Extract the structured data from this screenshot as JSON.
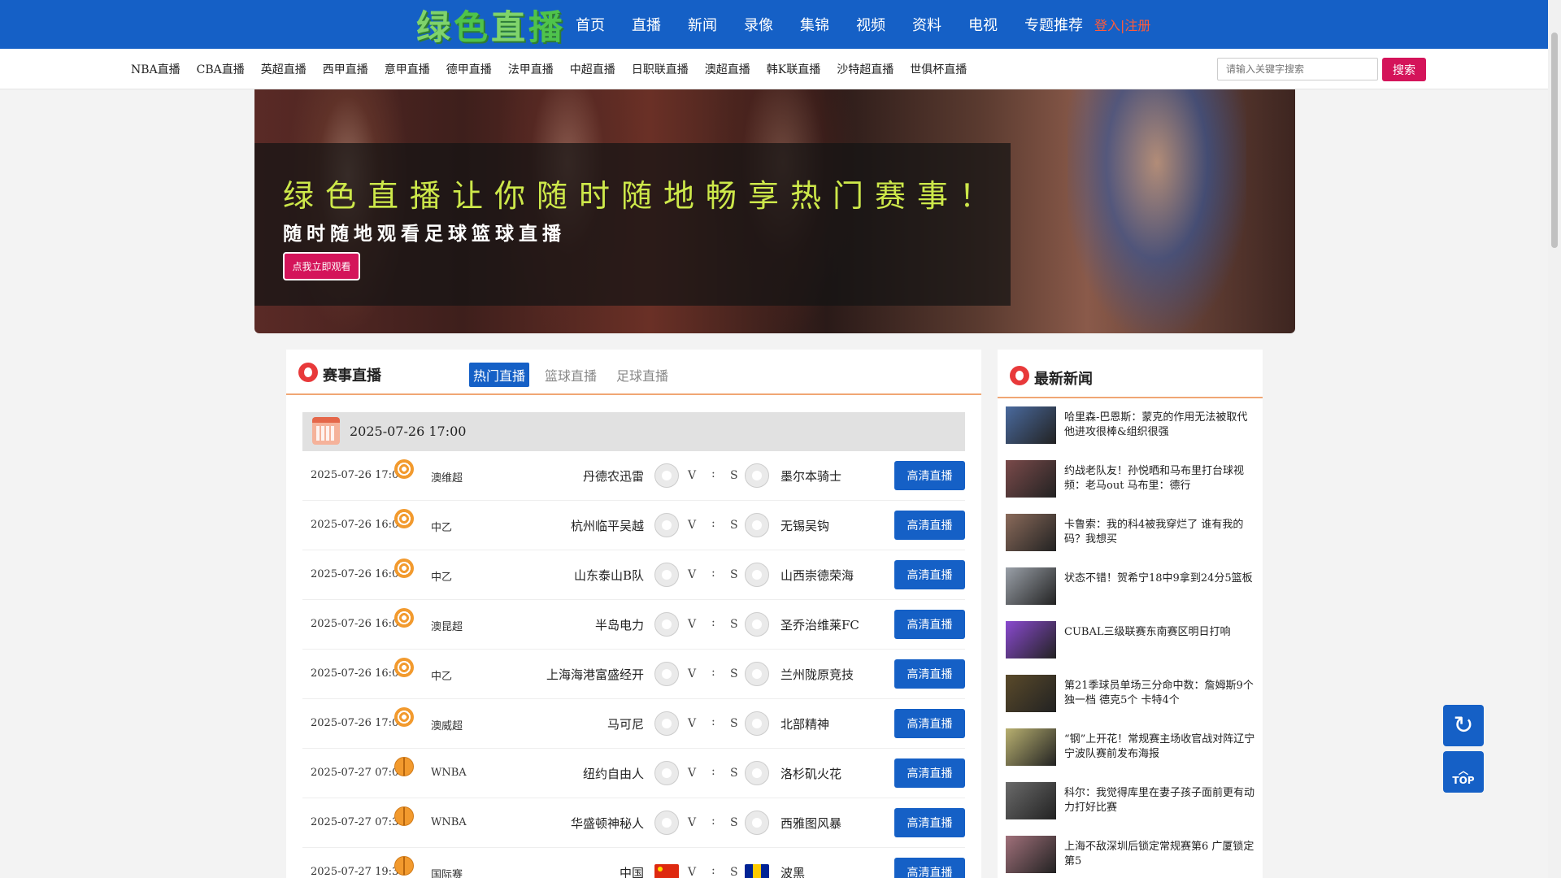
{
  "header": {
    "logo_chars": [
      "绿",
      "色",
      "直",
      "播"
    ],
    "nav": [
      "首页",
      "直播",
      "新闻",
      "录像",
      "集锦",
      "视频",
      "资料",
      "电视",
      "专题推荐"
    ],
    "login": "登入|注册"
  },
  "subnav": {
    "links": [
      "NBA直播",
      "CBA直播",
      "英超直播",
      "西甲直播",
      "意甲直播",
      "德甲直播",
      "法甲直播",
      "中超直播",
      "日职联直播",
      "澳超直播",
      "韩K联直播",
      "沙特超直播",
      "世俱杯直播"
    ],
    "search_placeholder": "请输入关键字搜索",
    "search_button": "搜索"
  },
  "banner": {
    "headline": "绿色直播让你随时随地畅享热门赛事！",
    "subline": "随时随地观看足球篮球直播",
    "cta": "点我立即观看"
  },
  "live": {
    "title": "赛事直播",
    "tabs": [
      "热门直播",
      "篮球直播",
      "足球直播"
    ],
    "date": "2025-07-26 17:00",
    "matches": [
      {
        "time": "2025-07-26 17:00",
        "sport": "soccer",
        "league": "澳维超",
        "home": "丹德农迅雷",
        "away": "墨尔本骑士",
        "v": "V",
        "colon": ":",
        "s": "S",
        "button": "高清直播"
      },
      {
        "time": "2025-07-26 16:00",
        "sport": "soccer",
        "league": "中乙",
        "home": "杭州临平吴越",
        "away": "无锡吴钩",
        "v": "V",
        "colon": ":",
        "s": "S",
        "button": "高清直播"
      },
      {
        "time": "2025-07-26 16:00",
        "sport": "soccer",
        "league": "中乙",
        "home": "山东泰山B队",
        "away": "山西崇德荣海",
        "v": "V",
        "colon": ":",
        "s": "S",
        "button": "高清直播"
      },
      {
        "time": "2025-07-26 16:00",
        "sport": "soccer",
        "league": "澳昆超",
        "home": "半岛电力",
        "away": "圣乔治维莱FC",
        "v": "V",
        "colon": ":",
        "s": "S",
        "button": "高清直播"
      },
      {
        "time": "2025-07-26 16:00",
        "sport": "soccer",
        "league": "中乙",
        "home": "上海海港富盛经开",
        "away": "兰州陇原竞技",
        "v": "V",
        "colon": ":",
        "s": "S",
        "button": "高清直播"
      },
      {
        "time": "2025-07-26 17:00",
        "sport": "soccer",
        "league": "澳威超",
        "home": "马可尼",
        "away": "北部精神",
        "v": "V",
        "colon": ":",
        "s": "S",
        "button": "高清直播"
      },
      {
        "time": "2025-07-27 07:00",
        "sport": "basket",
        "league": "WNBA",
        "home": "纽约自由人",
        "away": "洛杉矶火花",
        "v": "V",
        "colon": ":",
        "s": "S",
        "button": "高清直播"
      },
      {
        "time": "2025-07-27 07:30",
        "sport": "basket",
        "league": "WNBA",
        "home": "华盛顿神秘人",
        "away": "西雅图风暴",
        "v": "V",
        "colon": ":",
        "s": "S",
        "button": "高清直播"
      },
      {
        "time": "2025-07-27 19:30",
        "sport": "basket",
        "league": "国际赛",
        "home": "中国",
        "away": "波黑",
        "v": "V",
        "colon": ":",
        "s": "S",
        "button": "高清直播"
      }
    ]
  },
  "news": {
    "title": "最新新闻",
    "items": [
      {
        "text": "哈里森-巴恩斯：蒙克的作用无法被取代 他进攻很棒&组织很强",
        "thumb": "#4a6a9e"
      },
      {
        "text": "约战老队友！孙悦晒和马布里打台球视频：老马out 马布里：德行",
        "thumb": "#7a4a4a"
      },
      {
        "text": "卡鲁索：我的科4被我穿烂了 谁有我的码？我想买",
        "thumb": "#8a6a5a"
      },
      {
        "text": "状态不错！贺希宁18中9拿到24分5篮板",
        "thumb": "#9aa0a8"
      },
      {
        "text": "CUBAL三级联赛东南赛区明日打响",
        "thumb": "#8a4ad0"
      },
      {
        "text": "第21季球员单场三分命中数：詹姆斯9个独一档 德克5个 卡特4个",
        "thumb": "#5a4a2a"
      },
      {
        "text": "“钢”上开花！常规赛主场收官战对阵辽宁宁波队赛前发布海报",
        "thumb": "#b8b070"
      },
      {
        "text": "科尔：我觉得库里在妻子孩子面前更有动力打好比赛",
        "thumb": "#6a6a6a"
      },
      {
        "text": "上海不敌深圳后锁定常规赛第6 广厦锁定第5",
        "thumb": "#a0707a"
      }
    ]
  },
  "floating": {
    "refresh": "↻",
    "top_chevron": "︿",
    "top": "TOP"
  }
}
